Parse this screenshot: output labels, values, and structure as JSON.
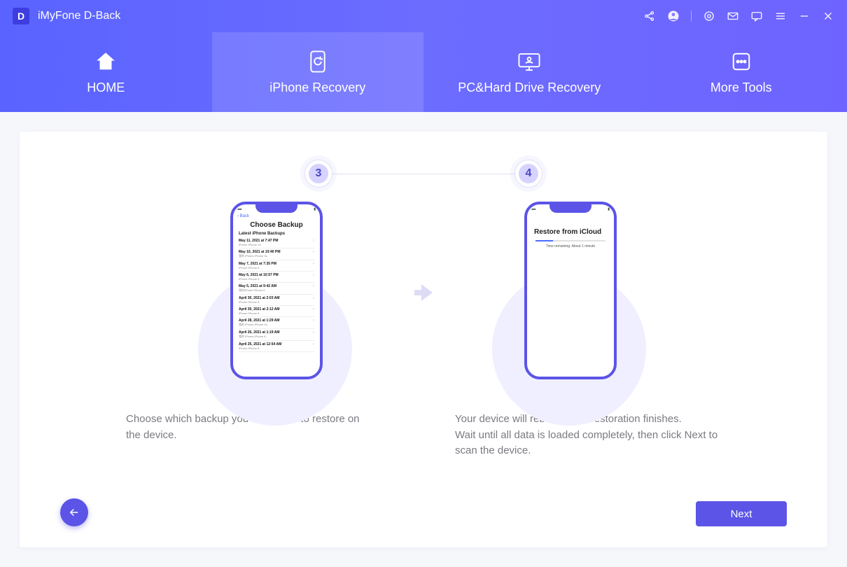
{
  "app": {
    "logo_letter": "D",
    "title": "iMyFone D-Back"
  },
  "nav": {
    "home": "HOME",
    "iphone": "iPhone Recovery",
    "pc": "PC&Hard Drive Recovery",
    "more": "More Tools"
  },
  "steps": {
    "num_left": "3",
    "num_right": "4"
  },
  "phone_left": {
    "back_label": "‹ Back",
    "heading": "Choose Backup",
    "subheading": "Latest iPhone Backups",
    "rows": [
      {
        "l1": "May 11, 2021 at 7:47 PM",
        "l2": "iPhone iPhone Xs"
      },
      {
        "l1": "May 10, 2021 at 10:40 PM",
        "l2": "我的 iPhone iPhone Xs"
      },
      {
        "l1": "May 7, 2021 at 7:35 PM",
        "l2": "iPhone iPhone 8"
      },
      {
        "l1": "May 6, 2021 at 10:57 PM",
        "l2": "iPhone iPhone 8"
      },
      {
        "l1": "May 5, 2021 at 9:42 AM",
        "l2": "我的iPhone iPhone 8"
      },
      {
        "l1": "April 30, 2021 at 2:03 AM",
        "l2": "iPhone iPhone 8"
      },
      {
        "l1": "April 30, 2021 at 2:12 AM",
        "l2": "iPhone iPhone 8"
      },
      {
        "l1": "April 28, 2021 at 1:29 AM",
        "l2": "我的 iPhone iPhone Xs"
      },
      {
        "l1": "April 26, 2021 at 1:19 AM",
        "l2": "我的 iPhone iPhone 8"
      },
      {
        "l1": "April 25, 2021 at 12:54 AM",
        "l2": "iPhone iPhone 8"
      }
    ]
  },
  "phone_right": {
    "heading": "Restore from iCloud",
    "progress_text": "Time remaining: About 1 minute"
  },
  "captions": {
    "left": "Choose which backup you would like to restore on the device.",
    "right": "Your device will reboot when restoration finishes.\nWait until all data is loaded completely, then click Next to scan the device."
  },
  "buttons": {
    "next": "Next"
  }
}
